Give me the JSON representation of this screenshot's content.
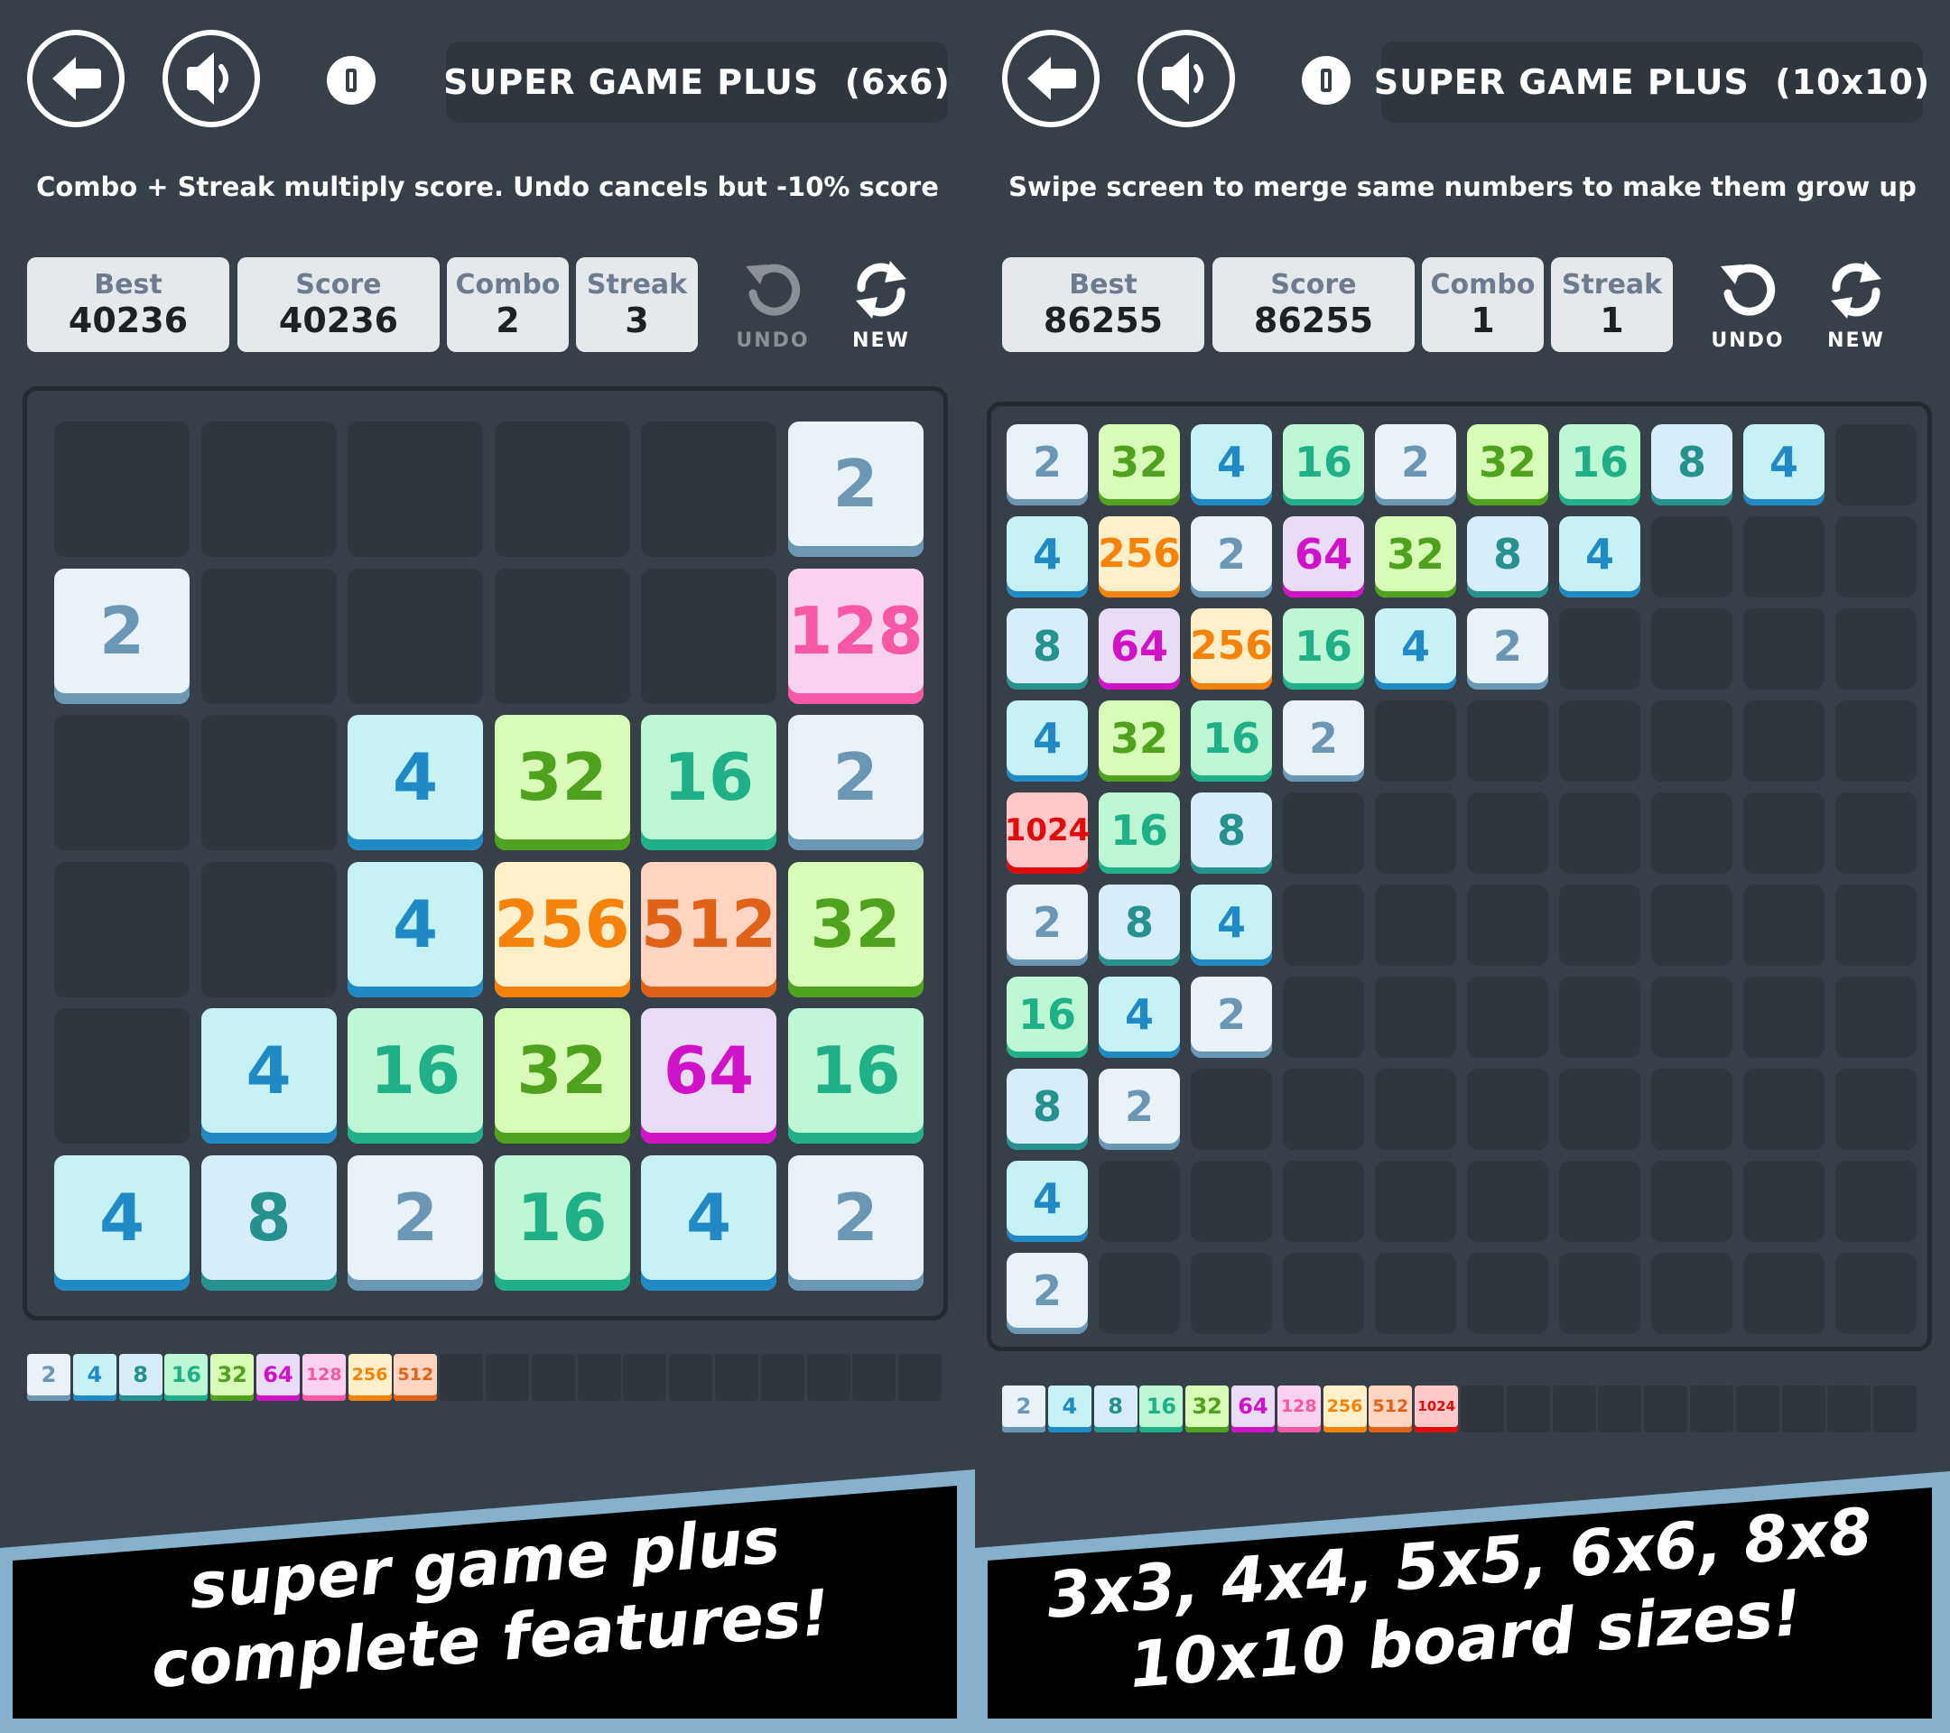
{
  "tile_styles": {
    "2": {
      "bg": "#e8f2f7",
      "fg": "#6b97b5",
      "edge": "#6b97b5"
    },
    "4": {
      "bg": "#c6f2f6",
      "fg": "#2189c4",
      "edge": "#2189c4"
    },
    "8": {
      "bg": "#d8edfa",
      "fg": "#27918d",
      "edge": "#27918d"
    },
    "16": {
      "bg": "#bdf7d6",
      "fg": "#20b087",
      "edge": "#20b087"
    },
    "32": {
      "bg": "#d8fcb7",
      "fg": "#4ea21f",
      "edge": "#4ea21f"
    },
    "64": {
      "bg": "#e8dcf6",
      "fg": "#d013c7",
      "edge": "#d013c7"
    },
    "128": {
      "bg": "#fad2ef",
      "fg": "#f658a5",
      "edge": "#f658a5"
    },
    "256": {
      "bg": "#fff0c9",
      "fg": "#f5820a",
      "edge": "#f5820a"
    },
    "512": {
      "bg": "#ffd5c2",
      "fg": "#e06218",
      "edge": "#e06218"
    },
    "1024": {
      "bg": "#ffc9c9",
      "fg": "#e00b0b",
      "edge": "#e00b0b"
    }
  },
  "panels": [
    {
      "title": "SUPER GAME PLUS  (6x6)",
      "subtitle": "Combo + Streak multiply score. Undo cancels but -10% score",
      "stats": [
        {
          "label": "Best",
          "value": "40236"
        },
        {
          "label": "Score",
          "value": "40236"
        },
        {
          "label": "Combo",
          "value": "2"
        },
        {
          "label": "Streak",
          "value": "3"
        }
      ],
      "undo_label": "UNDO",
      "undo_enabled": false,
      "new_label": "NEW",
      "board_size": 6,
      "grid": [
        [
          0,
          0,
          0,
          0,
          0,
          2
        ],
        [
          2,
          0,
          0,
          0,
          0,
          128
        ],
        [
          0,
          0,
          4,
          32,
          16,
          2
        ],
        [
          0,
          0,
          4,
          256,
          512,
          32
        ],
        [
          0,
          4,
          16,
          32,
          64,
          16
        ],
        [
          4,
          8,
          2,
          16,
          4,
          2
        ]
      ],
      "legend": [
        "2",
        "4",
        "8",
        "16",
        "32",
        "64",
        "128",
        "256",
        "512",
        "",
        "",
        "",
        "",
        "",
        "",
        "",
        "",
        "",
        "",
        ""
      ],
      "banner_lines": [
        "super game plus",
        "complete features!"
      ]
    },
    {
      "title": "SUPER GAME PLUS  (10x10)",
      "subtitle": "Swipe screen to merge same numbers to make them grow up",
      "stats": [
        {
          "label": "Best",
          "value": "86255"
        },
        {
          "label": "Score",
          "value": "86255"
        },
        {
          "label": "Combo",
          "value": "1"
        },
        {
          "label": "Streak",
          "value": "1"
        }
      ],
      "undo_label": "UNDO",
      "undo_enabled": true,
      "new_label": "NEW",
      "board_size": 10,
      "grid": [
        [
          2,
          32,
          4,
          16,
          2,
          32,
          16,
          8,
          4,
          0
        ],
        [
          4,
          256,
          2,
          64,
          32,
          8,
          4,
          0,
          0,
          0
        ],
        [
          8,
          64,
          256,
          16,
          4,
          2,
          0,
          0,
          0,
          0
        ],
        [
          4,
          32,
          16,
          2,
          0,
          0,
          0,
          0,
          0,
          0
        ],
        [
          1024,
          16,
          8,
          0,
          0,
          0,
          0,
          0,
          0,
          0
        ],
        [
          2,
          8,
          4,
          0,
          0,
          0,
          0,
          0,
          0,
          0
        ],
        [
          16,
          4,
          2,
          0,
          0,
          0,
          0,
          0,
          0,
          0
        ],
        [
          8,
          2,
          0,
          0,
          0,
          0,
          0,
          0,
          0,
          0
        ],
        [
          4,
          0,
          0,
          0,
          0,
          0,
          0,
          0,
          0,
          0
        ],
        [
          2,
          0,
          0,
          0,
          0,
          0,
          0,
          0,
          0,
          0
        ]
      ],
      "legend": [
        "2",
        "4",
        "8",
        "16",
        "32",
        "64",
        "128",
        "256",
        "512",
        "1024",
        "",
        "",
        "",
        "",
        "",
        "",
        "",
        "",
        "",
        ""
      ],
      "banner_lines": [
        "3x3, 4x4, 5x5, 6x6, 8x8",
        "10x10 board sizes!"
      ]
    }
  ],
  "colors": {
    "background": "#373f48",
    "banner_border": "#86b1cc",
    "banner_fill": "#000000",
    "undo_disabled": "#8a9096"
  }
}
